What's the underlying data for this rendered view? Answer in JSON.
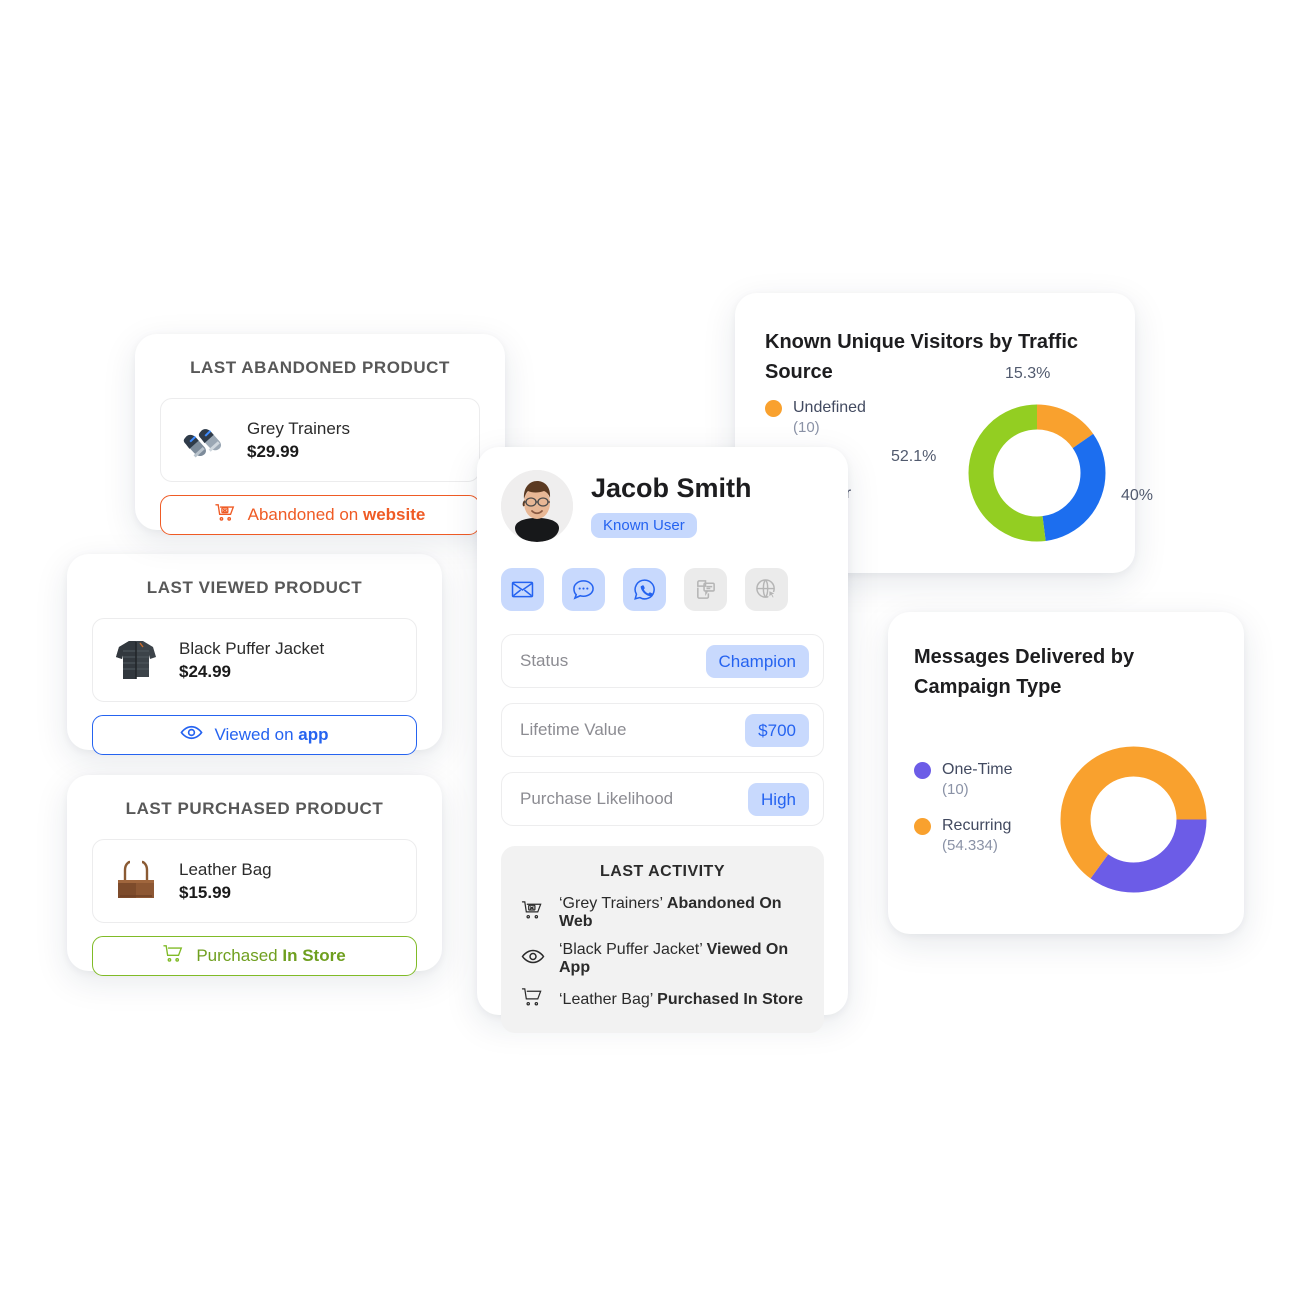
{
  "theme": {
    "orange": "#F9A12E",
    "orange_accent": "#EF5B25",
    "green": "#93CE22",
    "blue": "#1C6EEF",
    "purple": "#6C5CE7",
    "chip_blue": "#2563F0",
    "chip_bg": "#C8D9FD",
    "muted": "#8A92A6"
  },
  "cards": {
    "abandoned": {
      "title": "LAST ABANDONED PRODUCT",
      "product_name": "Grey Trainers",
      "product_price": "$29.99",
      "thumb_icon": "grey-trainers-thumbnail",
      "button_prefix": "Abandoned on",
      "button_strong": "website",
      "button_icon": "abandoned-cart-icon"
    },
    "viewed": {
      "title": "LAST VIEWED PRODUCT",
      "product_name": "Black Puffer Jacket",
      "product_price": "$24.99",
      "thumb_icon": "black-puffer-jacket-thumbnail",
      "button_prefix": "Viewed on",
      "button_strong": "app",
      "button_icon": "eye-icon"
    },
    "purchased": {
      "title": "LAST PURCHASED PRODUCT",
      "product_name": "Leather Bag",
      "product_price": "$15.99",
      "thumb_icon": "leather-bag-thumbnail",
      "button_prefix": "Purchased",
      "button_strong": "In Store",
      "button_icon": "cart-icon"
    }
  },
  "profile": {
    "name": "Jacob Smith",
    "badge": "Known User",
    "avatar_icon": "user-avatar",
    "channels": [
      {
        "name": "email-channel-icon",
        "label": "Email",
        "active": true
      },
      {
        "name": "sms-channel-icon",
        "label": "SMS",
        "active": true
      },
      {
        "name": "whatsapp-channel-icon",
        "label": "WhatsApp",
        "active": true
      },
      {
        "name": "push-notification-channel-icon",
        "label": "Mobile Push",
        "active": false
      },
      {
        "name": "web-push-channel-icon",
        "label": "Web Push",
        "active": false
      }
    ],
    "attributes": [
      {
        "label": "Status",
        "value": "Champion"
      },
      {
        "label": "Lifetime Value",
        "value": "$700"
      },
      {
        "label": "Purchase Likelihood",
        "value": "High"
      }
    ],
    "activity_title": "LAST ACTIVITY",
    "activity": [
      {
        "icon": "abandoned-cart-icon",
        "product": "‘Grey Trainers’",
        "action": "Abandoned On Web"
      },
      {
        "icon": "eye-icon",
        "product": "‘Black Puffer Jacket’",
        "action": "Viewed On App"
      },
      {
        "icon": "cart-icon",
        "product": "‘Leather Bag’",
        "action": "Purchased In Store"
      }
    ]
  },
  "chart_data": [
    {
      "type": "pie",
      "id": "known-unique-visitors-by-traffic-source",
      "title": "Known Unique Visitors by Traffic Source",
      "legend_position": "left",
      "categories": [
        "Undefined",
        "Subscriber"
      ],
      "legend": [
        {
          "label": "Undefined",
          "count": "(10)",
          "color": "#F9A12E"
        },
        {
          "label": "ber",
          "count": "",
          "color": "#93CE22"
        }
      ],
      "slices": [
        {
          "label": "15.3%",
          "value": 15.3,
          "color": "#F9A12E"
        },
        {
          "label": "40%",
          "value": 40,
          "color": "#1C6EEF"
        },
        {
          "label": "52.1%",
          "value": 52.1,
          "color": "#93CE22"
        }
      ]
    },
    {
      "type": "pie",
      "id": "messages-delivered-by-campaign-type",
      "title": "Messages Delivered by Campaign Type",
      "legend_position": "left",
      "categories": [
        "One-Time",
        "Recurring"
      ],
      "legend": [
        {
          "label": "One-Time",
          "count": "(10)",
          "color": "#6C5CE7"
        },
        {
          "label": "Recurring",
          "count": "(54.334)",
          "color": "#F9A12E"
        }
      ],
      "slices": [
        {
          "label": "One-Time",
          "value": 35,
          "color": "#6C5CE7"
        },
        {
          "label": "Recurring",
          "value": 65,
          "color": "#F9A12E"
        }
      ]
    }
  ]
}
